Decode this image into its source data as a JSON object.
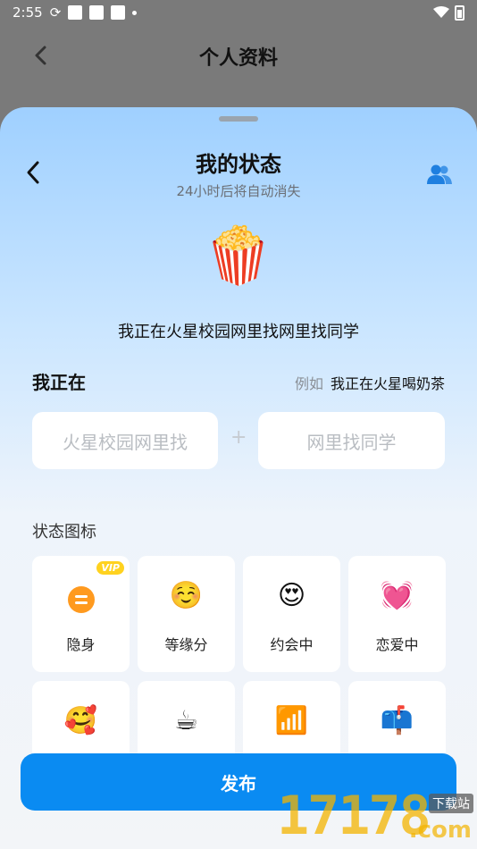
{
  "status_bar": {
    "time": "2:55"
  },
  "underlying_page": {
    "title": "个人资料"
  },
  "sheet": {
    "title": "我的状态",
    "subtitle": "24小时后将自动消失",
    "hero_emoji": "🍿",
    "hero_text": "我正在火星校园网里找网里找同学",
    "section_label": "我正在",
    "example_prefix": "例如",
    "example_text": "我正在火星喝奶茶",
    "input_a_placeholder": "火星校园网里找",
    "input_b_placeholder": "网里找同学",
    "plus": "+",
    "icons_label": "状态图标",
    "vip_badge": "VIP",
    "icons": [
      {
        "emoji": "",
        "label": "隐身",
        "icon": "hide-icon"
      },
      {
        "emoji": "☺️",
        "label": "等缘分",
        "icon": "smiling-face-icon"
      },
      {
        "emoji": "😍",
        "label": "约会中",
        "icon": "heart-eyes-icon"
      },
      {
        "emoji": "💓",
        "label": "恋爱中",
        "icon": "beating-heart-icon"
      },
      {
        "emoji": "🥰",
        "label": "",
        "icon": "smiling-hearts-icon"
      },
      {
        "emoji": "☕",
        "label": "",
        "icon": "coffee-icon"
      },
      {
        "emoji": "📶",
        "label": "",
        "icon": "signal-bars-icon"
      },
      {
        "emoji": "📫",
        "label": "",
        "icon": "mailbox-icon"
      }
    ],
    "publish_label": "发布"
  },
  "watermark": {
    "number": "17178",
    "suffix": ".com",
    "tag": "下载站"
  },
  "colors": {
    "accent": "#0a8bf2",
    "sheet_top": "#9fd0ff",
    "vip": "#ffd21f",
    "hide_orange": "#ff9a1f"
  }
}
